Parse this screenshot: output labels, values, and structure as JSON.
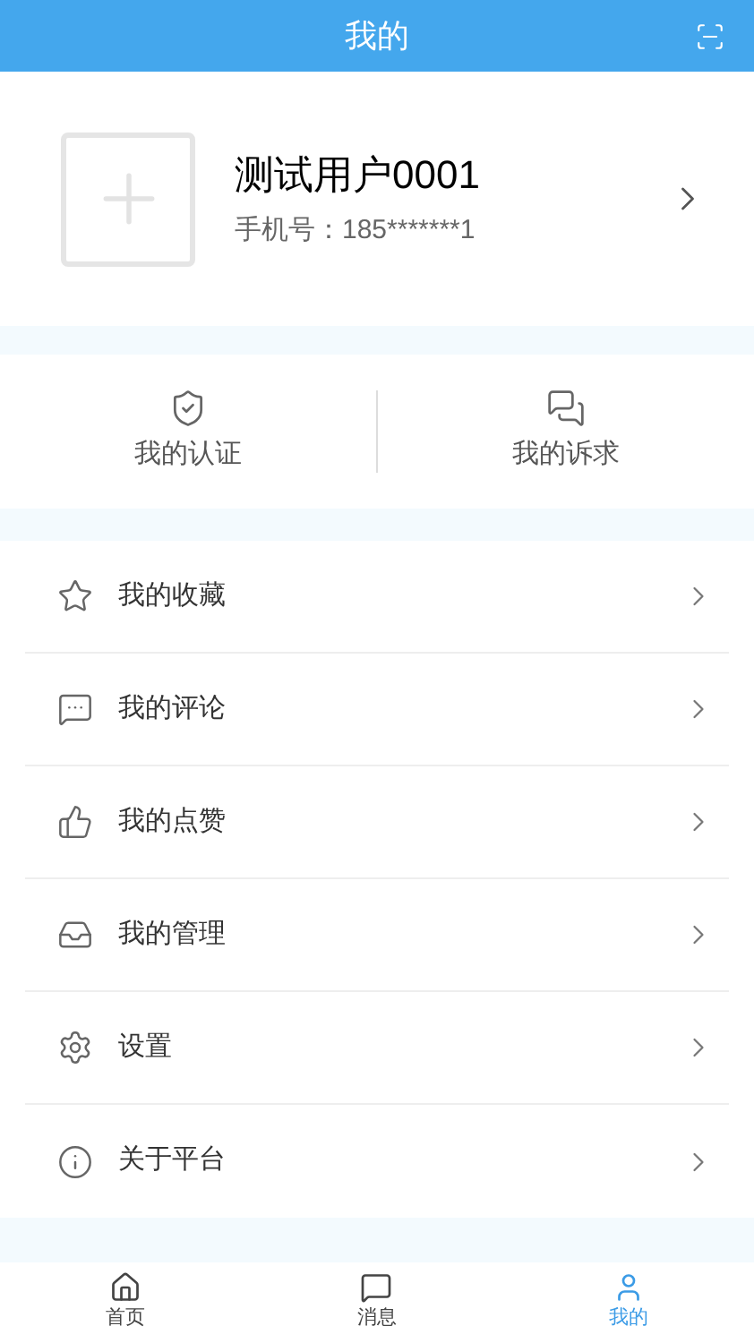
{
  "header": {
    "title": "我的"
  },
  "profile": {
    "name": "测试用户0001",
    "phone": "手机号：185*******1"
  },
  "actions": [
    {
      "label": "我的认证"
    },
    {
      "label": "我的诉求"
    }
  ],
  "menu": [
    {
      "label": "我的收藏"
    },
    {
      "label": "我的评论"
    },
    {
      "label": "我的点赞"
    },
    {
      "label": "我的管理"
    },
    {
      "label": "设置"
    },
    {
      "label": "关于平台"
    }
  ],
  "tabbar": [
    {
      "label": "首页",
      "selected": false
    },
    {
      "label": "消息",
      "selected": false
    },
    {
      "label": "我的",
      "selected": true
    }
  ]
}
